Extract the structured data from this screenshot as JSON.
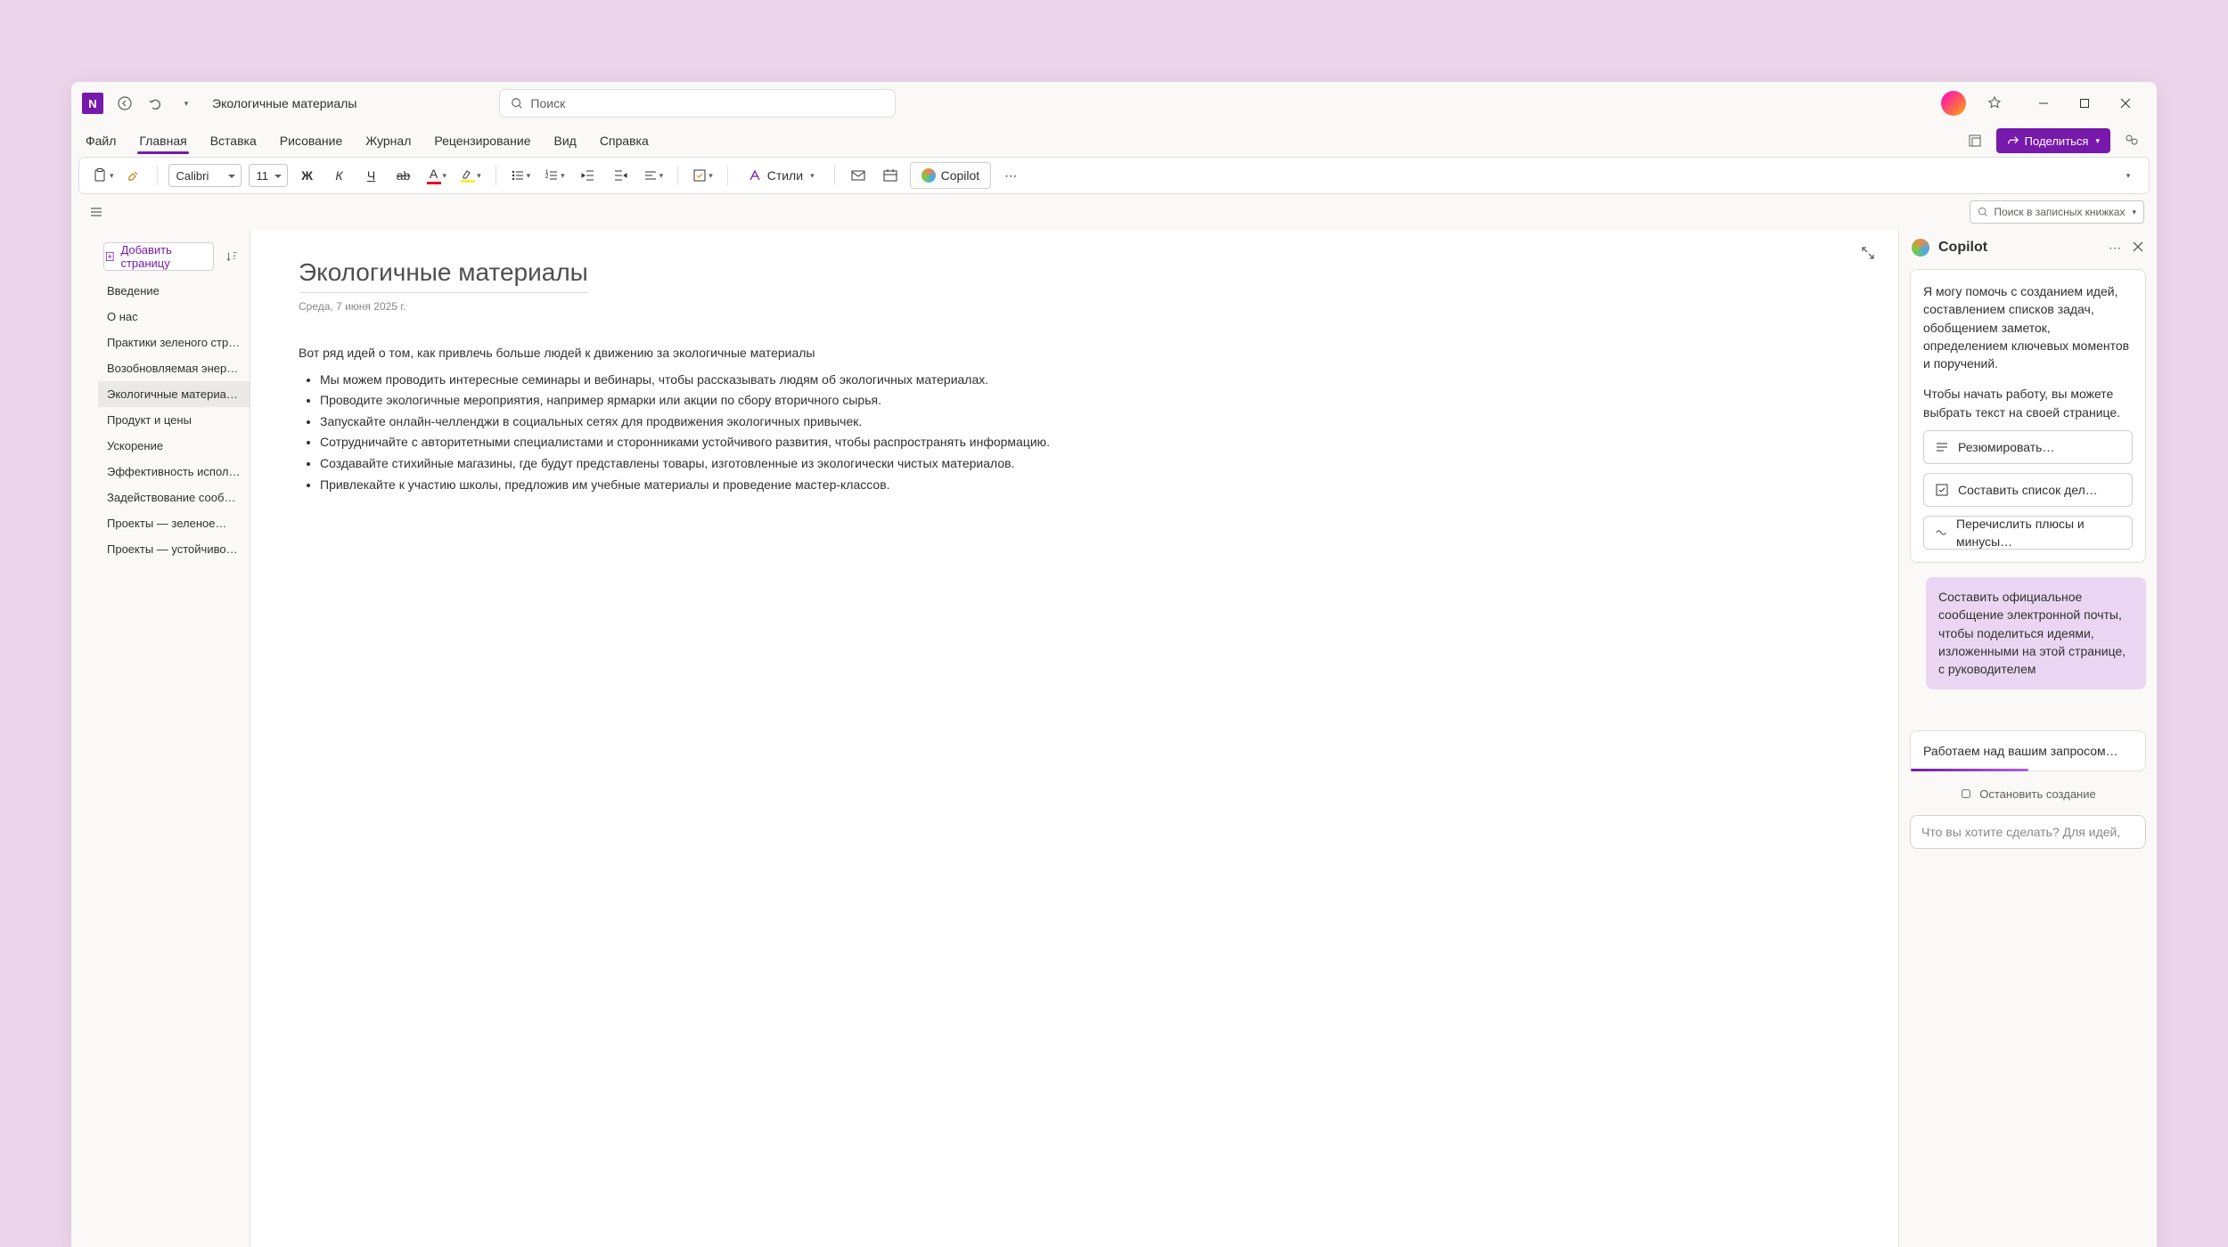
{
  "app": {
    "letter": "N",
    "doc_title": "Экологичные материалы"
  },
  "search": {
    "placeholder": "Поиск"
  },
  "ribbon": {
    "tabs": [
      "Файл",
      "Главная",
      "Вставка",
      "Рисование",
      "Журнал",
      "Рецензирование",
      "Вид",
      "Справка"
    ],
    "active_index": 1,
    "share": "Поделиться"
  },
  "toolbar": {
    "font": "Calibri",
    "size": "11",
    "styles": "Стили",
    "copilot": "Copilot"
  },
  "notebook_search": "Поиск в записных книжках",
  "pages": {
    "add": "Добавить страницу",
    "items": [
      "Введение",
      "О нас",
      "Практики зеленого стро…",
      "Возобновляемая энергия…",
      "Экологичные материалы",
      "Продукт и цены",
      "Ускорение",
      "Эффективность использ…",
      "Задействование сообщ…",
      "Проекты — зеленое…",
      "Проекты — устойчивое…"
    ],
    "selected_index": 4
  },
  "page": {
    "title": "Экологичные материалы",
    "date": "Среда, 7 июня 2025 г.",
    "intro": "Вот ряд идей о том, как привлечь больше людей к движению за экологичные материалы",
    "bullets": [
      "Мы можем проводить интересные семинары и вебинары, чтобы рассказывать людям об экологичных материалах.",
      "Проводите экологичные мероприятия, например ярмарки или акции по сбору вторичного сырья.",
      "Запускайте онлайн-челленджи в социальных сетях для продвижения экологичных привычек.",
      "Сотрудничайте с авторитетными специалистами и сторонниками устойчивого развития, чтобы распространять информацию.",
      "Создавайте стихийные магазины, где будут представлены товары, изготовленные из экологически чистых материалов.",
      "Привлекайте к участию школы, предложив им учебные материалы и проведение мастер-классов."
    ]
  },
  "copilot": {
    "title": "Copilot",
    "intro1": "Я могу помочь с созданием идей, составлением списков задач, обобщением заметок, определением ключевых моментов и поручений.",
    "intro2": "Чтобы начать работу, вы можете выбрать текст на своей странице.",
    "actions": [
      "Резюмировать…",
      "Составить список дел…",
      "Перечислить плюсы и минусы…"
    ],
    "user_message": "Составить официальное сообщение электронной почты, чтобы поделиться идеями, изложенными на этой странице, с руководителем",
    "working": "Работаем над вашим запросом…",
    "stop": "Остановить создание",
    "input_placeholder": "Что вы хотите сделать? Для идей,"
  }
}
